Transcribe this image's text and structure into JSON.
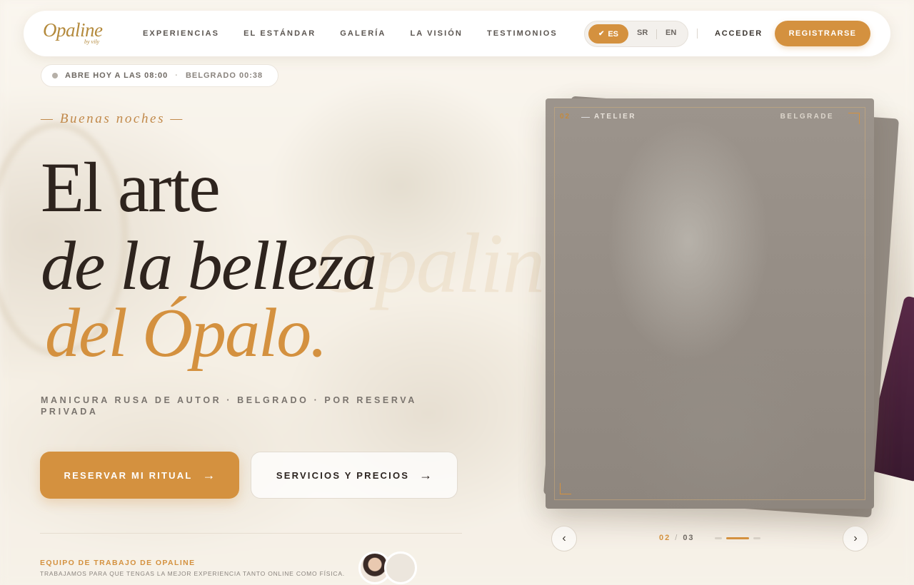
{
  "brand": {
    "name": "Opaline",
    "sub": "by vily"
  },
  "nav": {
    "links": [
      "EXPERIENCIAS",
      "EL ESTÁNDAR",
      "GALERÍA",
      "LA VISIÓN",
      "TESTIMONIOS"
    ],
    "languages": {
      "active": "ES",
      "options": [
        "SR",
        "EN"
      ]
    },
    "login_label": "ACCEDER",
    "register_label": "REGISTRARSE"
  },
  "status": {
    "open_text": "ABRE HOY A LAS 08:00",
    "separator": "·",
    "city_time": "BELGRADO 00:38"
  },
  "hero": {
    "greeting": "— Buenas noches —",
    "title_line1": "El arte",
    "title_line2": "de la belleza",
    "title_line3": "del Ópalo.",
    "tagline": "MANICURA RUSA DE AUTOR · BELGRADO · POR RESERVA PRIVADA",
    "primary_button": "RESERVAR MI RITUAL",
    "secondary_button": "SERVICIOS Y PRECIOS",
    "arrow": "→"
  },
  "team": {
    "title": "EQUIPO DE TRABAJO DE OPALINE",
    "subtitle": "TRABAJAMOS PARA QUE TENGAS LA MEJOR EXPERIENCIA TANTO ONLINE COMO FÍSICA."
  },
  "gallery": {
    "slide_number": "02",
    "slide_label": "ATELIER",
    "slide_city": "BELGRADE",
    "current": "02",
    "total": "03",
    "divider": "/",
    "prev_icon": "‹",
    "next_icon": "›"
  },
  "background": {
    "watermark": "Opaline"
  },
  "colors": {
    "accent": "#d4913f",
    "dark": "#2e241e",
    "background": "#f7f2ea"
  }
}
